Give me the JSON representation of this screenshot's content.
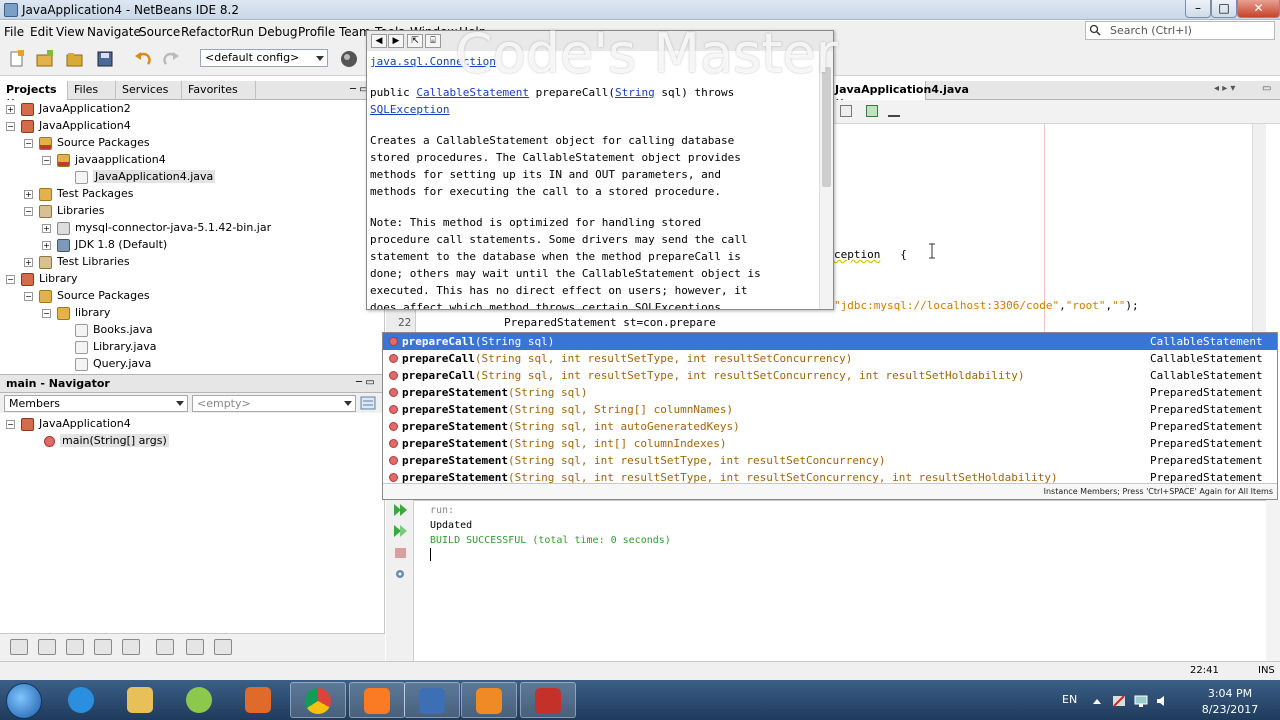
{
  "window": {
    "title": "JavaApplication4 - NetBeans IDE 8.2"
  },
  "menubar": {
    "items": [
      "File",
      "Edit",
      "View",
      "Navigate",
      "Source",
      "Refactor",
      "Run",
      "Debug",
      "Profile",
      "Team",
      "Tools",
      "Window",
      "Help"
    ]
  },
  "search": {
    "placeholder": "Search (Ctrl+I)"
  },
  "toolbar": {
    "config": "<default config>"
  },
  "project_tabs": [
    "Projects",
    "Files",
    "Services",
    "Favorites"
  ],
  "project_tree": [
    {
      "label": "JavaApplication2",
      "level": 0,
      "icon": "proj"
    },
    {
      "label": "JavaApplication4",
      "level": 0,
      "icon": "proj"
    },
    {
      "label": "Source Packages",
      "level": 1,
      "icon": "pkgsrc"
    },
    {
      "label": "javaapplication4",
      "level": 2,
      "icon": "pkgsrc"
    },
    {
      "label": "JavaApplication4.java",
      "level": 3,
      "icon": "java",
      "selected": true
    },
    {
      "label": "Test Packages",
      "level": 1,
      "icon": "pkg"
    },
    {
      "label": "Libraries",
      "level": 1,
      "icon": "lib"
    },
    {
      "label": "mysql-connector-java-5.1.42-bin.jar",
      "level": 2,
      "icon": "jar"
    },
    {
      "label": "JDK 1.8 (Default)",
      "level": 2,
      "icon": "jdk"
    },
    {
      "label": "Test Libraries",
      "level": 1,
      "icon": "lib"
    },
    {
      "label": "Library",
      "level": 0,
      "icon": "proj"
    },
    {
      "label": "Source Packages",
      "level": 1,
      "icon": "pkg"
    },
    {
      "label": "library",
      "level": 2,
      "icon": "pkg"
    },
    {
      "label": "Books.java",
      "level": 3,
      "icon": "java"
    },
    {
      "label": "Library.java",
      "level": 3,
      "icon": "java"
    },
    {
      "label": "Query.java",
      "level": 3,
      "icon": "java"
    }
  ],
  "navigator": {
    "title": "main - Navigator",
    "filter": "Members",
    "filter2": "<empty>",
    "root": "JavaApplication4",
    "child": "main(String[] args)"
  },
  "editor": {
    "tab": "JavaApplication4.java",
    "line_number": "22",
    "code_exception": "ception",
    "code_brace": "{",
    "code_conn_url": "\"jdbc:mysql://localhost:3306/code\"",
    "code_conn_sep": ",",
    "code_conn_user": "\"root\"",
    "code_conn_pass": "\"\"",
    "code_conn_end": ");",
    "code_line22": "PreparedStatement st=con.prepare"
  },
  "javadoc": {
    "watermark": "Code's Master",
    "class_link": "java.sql.Connection",
    "sig_public": "public ",
    "sig_type": "CallableStatement",
    "sig_name": " prepareCall(",
    "sig_param_type": "String",
    "sig_param": " sql) throws",
    "sig_exception": "SQLException",
    "para1": [
      "Creates a CallableStatement object for calling database",
      "stored procedures. The CallableStatement object provides",
      "methods for setting up its IN and OUT parameters, and",
      "methods for executing the call to a stored procedure."
    ],
    "para2": [
      "Note: This method is optimized for handling stored",
      "procedure call statements. Some drivers may send the call",
      "statement to the database when the method prepareCall is",
      "done; others may wait until the CallableStatement object is",
      "executed. This has no direct effect on users; however, it",
      "does affect which method throws certain SQLExceptions."
    ]
  },
  "completion": {
    "items": [
      {
        "name": "prepareCall",
        "params": "(String sql)",
        "ret": "CallableStatement",
        "selected": true
      },
      {
        "name": "prepareCall",
        "params": "(String sql, int resultSetType, int resultSetConcurrency)",
        "ret": "CallableStatement"
      },
      {
        "name": "prepareCall",
        "params": "(String sql, int resultSetType, int resultSetConcurrency, int resultSetHoldability)",
        "ret": "CallableStatement"
      },
      {
        "name": "prepareStatement",
        "params": "(String sql)",
        "ret": "PreparedStatement"
      },
      {
        "name": "prepareStatement",
        "params": "(String sql, String[] columnNames)",
        "ret": "PreparedStatement"
      },
      {
        "name": "prepareStatement",
        "params": "(String sql, int autoGeneratedKeys)",
        "ret": "PreparedStatement"
      },
      {
        "name": "prepareStatement",
        "params": "(String sql, int[] columnIndexes)",
        "ret": "PreparedStatement"
      },
      {
        "name": "prepareStatement",
        "params": "(String sql, int resultSetType, int resultSetConcurrency)",
        "ret": "PreparedStatement"
      },
      {
        "name": "prepareStatement",
        "params": "(String sql, int resultSetType, int resultSetConcurrency, int resultSetHoldability)",
        "ret": "PreparedStatement"
      }
    ],
    "hint": "Instance Members; Press 'Ctrl+SPACE' Again for All Items"
  },
  "output": {
    "lines": [
      "run:",
      "Updated",
      "BUILD SUCCESSFUL (total time: 0 seconds)"
    ]
  },
  "status": {
    "position": "22:41",
    "mode": "INS"
  },
  "taskbar": {
    "lang": "EN",
    "time": "3:04 PM",
    "date": "8/23/2017",
    "apps": [
      "ie-icon",
      "explorer-icon",
      "android-icon",
      "media-player-icon",
      "chrome-icon",
      "xampp-icon",
      "virtualbox-icon",
      "pdf-icon",
      "netbeans-icon"
    ]
  },
  "colors": {
    "selection": "#3875d7",
    "param": "#a2650a",
    "string": "#ce7b00",
    "link": "#1a3ebf",
    "success": "#2f9c2f"
  }
}
